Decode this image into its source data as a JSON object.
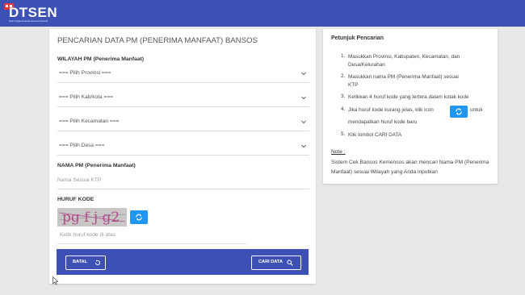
{
  "header": {
    "logo_text": "DTSEN",
    "logo_subtitle": "Data Tunggal Sosial dan Ekonomi Nasional",
    "colors": {
      "bar": "#3d51b4",
      "accent": "#e53935"
    }
  },
  "form": {
    "title": "PENCARIAN DATA PM (PENERIMA MANFAAT) BANSOS",
    "wilayah_label": "WILAYAH PM (Penerima Manfaat)",
    "selects": [
      {
        "text": "=== Pilih Provinsi ==="
      },
      {
        "text": "=== Pilih Kab/kota ==="
      },
      {
        "text": "=== Pilih Kecamatan ==="
      },
      {
        "text": "=== Pilih Desa ==="
      }
    ],
    "name_label": "NAMA PM (Penerima Manfaat)",
    "name_placeholder": "Nama Sesuai KTP",
    "captcha_label": "HURUF KODE",
    "captcha_text": "pg f j g2",
    "captcha_placeholder": "Ketik huruf kode di atas",
    "cancel_label": "BATAL",
    "search_label": "CARI DATA",
    "refresh_icon": "refresh-icon"
  },
  "instructions": {
    "title": "Petunjuk Pencarian",
    "steps": [
      {
        "num": "1.",
        "lines": [
          "Masukkan Provinsi, Kabupaten, Kecamatan, dan",
          "Desa/Kelurahan"
        ]
      },
      {
        "num": "2.",
        "lines": [
          "Masukkan nama PM (Penerima Manfaat) sesuai",
          "KTP"
        ]
      },
      {
        "num": "3.",
        "lines": [
          "Ketikkan 4 huruf kode yang tertera dalam kotak kode"
        ]
      },
      {
        "num": "4.",
        "lines": [
          "Jika huruf kode kurang jelas, klik icon",
          "untuk",
          "mendapatkan huruf kode baru"
        ]
      },
      {
        "num": "5.",
        "lines": [
          "Klik tombol CARI DATA"
        ]
      }
    ],
    "note_label": "Note :",
    "note_text": "Sistem Cek Bansos Kemensos akan mencari Nama PM (Penerima Manfaat) sesuai Wilayah yang Anda inputkan"
  }
}
